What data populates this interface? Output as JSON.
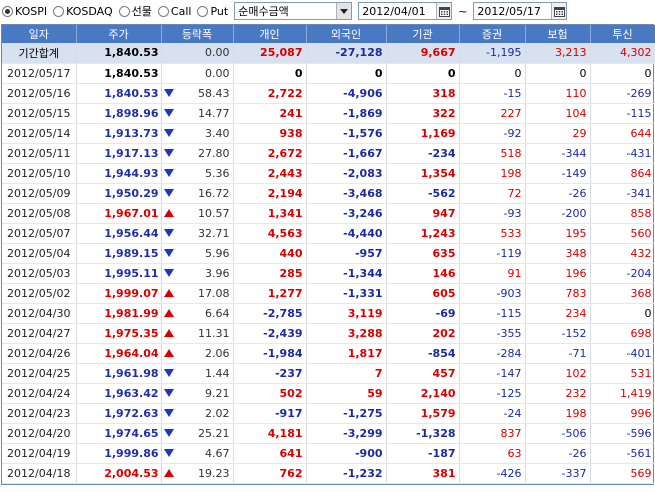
{
  "market_options": [
    {
      "label": "KOSPI",
      "selected": true
    },
    {
      "label": "KOSDAQ",
      "selected": false
    },
    {
      "label": "선물",
      "selected": false
    },
    {
      "label": "Call",
      "selected": false
    },
    {
      "label": "Put",
      "selected": false
    }
  ],
  "metric_select": {
    "value": "순매수금액"
  },
  "date_from": "2012/04/01",
  "date_sep": "~",
  "date_to": "2012/05/17",
  "columns": [
    "일자",
    "주가",
    "등락폭",
    "개인",
    "외국인",
    "기관",
    "증권",
    "보험",
    "투신"
  ],
  "rows": [
    {
      "date": "기간합계",
      "price": "1,840.53",
      "dir": "none",
      "chg": "0.00",
      "ind": "25,087",
      "for": "-27,128",
      "inst": "9,667",
      "sec": "-1,195",
      "ins": "3,213",
      "tru": "4,302",
      "total": true
    },
    {
      "date": "2012/05/17",
      "price": "1,840.53",
      "dir": "none",
      "chg": "0.00",
      "ind": "0",
      "for": "0",
      "inst": "0",
      "sec": "0",
      "ins": "0",
      "tru": "0"
    },
    {
      "date": "2012/05/16",
      "price": "1,840.53",
      "dir": "down",
      "chg": "58.43",
      "ind": "2,722",
      "for": "-4,906",
      "inst": "318",
      "sec": "-15",
      "ins": "110",
      "tru": "-269"
    },
    {
      "date": "2012/05/15",
      "price": "1,898.96",
      "dir": "down",
      "chg": "14.77",
      "ind": "241",
      "for": "-1,869",
      "inst": "322",
      "sec": "227",
      "ins": "104",
      "tru": "-115"
    },
    {
      "date": "2012/05/14",
      "price": "1,913.73",
      "dir": "down",
      "chg": "3.40",
      "ind": "938",
      "for": "-1,576",
      "inst": "1,169",
      "sec": "-92",
      "ins": "29",
      "tru": "644"
    },
    {
      "date": "2012/05/11",
      "price": "1,917.13",
      "dir": "down",
      "chg": "27.80",
      "ind": "2,672",
      "for": "-1,667",
      "inst": "-234",
      "sec": "518",
      "ins": "-344",
      "tru": "-431"
    },
    {
      "date": "2012/05/10",
      "price": "1,944.93",
      "dir": "down",
      "chg": "5.36",
      "ind": "2,443",
      "for": "-2,083",
      "inst": "1,354",
      "sec": "198",
      "ins": "-149",
      "tru": "864"
    },
    {
      "date": "2012/05/09",
      "price": "1,950.29",
      "dir": "down",
      "chg": "16.72",
      "ind": "2,194",
      "for": "-3,468",
      "inst": "-562",
      "sec": "72",
      "ins": "-26",
      "tru": "-341"
    },
    {
      "date": "2012/05/08",
      "price": "1,967.01",
      "dir": "up",
      "chg": "10.57",
      "ind": "1,341",
      "for": "-3,246",
      "inst": "947",
      "sec": "-93",
      "ins": "-200",
      "tru": "858"
    },
    {
      "date": "2012/05/07",
      "price": "1,956.44",
      "dir": "down",
      "chg": "32.71",
      "ind": "4,563",
      "for": "-4,440",
      "inst": "1,243",
      "sec": "533",
      "ins": "195",
      "tru": "560"
    },
    {
      "date": "2012/05/04",
      "price": "1,989.15",
      "dir": "down",
      "chg": "5.96",
      "ind": "440",
      "for": "-957",
      "inst": "635",
      "sec": "-119",
      "ins": "348",
      "tru": "432"
    },
    {
      "date": "2012/05/03",
      "price": "1,995.11",
      "dir": "down",
      "chg": "3.96",
      "ind": "285",
      "for": "-1,344",
      "inst": "146",
      "sec": "91",
      "ins": "196",
      "tru": "-204"
    },
    {
      "date": "2012/05/02",
      "price": "1,999.07",
      "dir": "up",
      "chg": "17.08",
      "ind": "1,277",
      "for": "-1,331",
      "inst": "605",
      "sec": "-903",
      "ins": "783",
      "tru": "368"
    },
    {
      "date": "2012/04/30",
      "price": "1,981.99",
      "dir": "up",
      "chg": "6.64",
      "ind": "-2,785",
      "for": "3,119",
      "inst": "-69",
      "sec": "-115",
      "ins": "234",
      "tru": "0"
    },
    {
      "date": "2012/04/27",
      "price": "1,975.35",
      "dir": "up",
      "chg": "11.31",
      "ind": "-2,439",
      "for": "3,288",
      "inst": "202",
      "sec": "-355",
      "ins": "-152",
      "tru": "698"
    },
    {
      "date": "2012/04/26",
      "price": "1,964.04",
      "dir": "up",
      "chg": "2.06",
      "ind": "-1,984",
      "for": "1,817",
      "inst": "-854",
      "sec": "-284",
      "ins": "-71",
      "tru": "-401"
    },
    {
      "date": "2012/04/25",
      "price": "1,961.98",
      "dir": "down",
      "chg": "1.44",
      "ind": "-237",
      "for": "7",
      "inst": "457",
      "sec": "-147",
      "ins": "102",
      "tru": "531"
    },
    {
      "date": "2012/04/24",
      "price": "1,963.42",
      "dir": "down",
      "chg": "9.21",
      "ind": "502",
      "for": "59",
      "inst": "2,140",
      "sec": "-125",
      "ins": "232",
      "tru": "1,419"
    },
    {
      "date": "2012/04/23",
      "price": "1,972.63",
      "dir": "down",
      "chg": "2.02",
      "ind": "-917",
      "for": "-1,275",
      "inst": "1,579",
      "sec": "-24",
      "ins": "198",
      "tru": "996"
    },
    {
      "date": "2012/04/20",
      "price": "1,974.65",
      "dir": "down",
      "chg": "25.21",
      "ind": "4,181",
      "for": "-3,299",
      "inst": "-1,328",
      "sec": "837",
      "ins": "-506",
      "tru": "-596"
    },
    {
      "date": "2012/04/19",
      "price": "1,999.86",
      "dir": "down",
      "chg": "4.67",
      "ind": "641",
      "for": "-900",
      "inst": "-187",
      "sec": "63",
      "ins": "-26",
      "tru": "-561"
    },
    {
      "date": "2012/04/18",
      "price": "2,004.53",
      "dir": "up",
      "chg": "19.23",
      "ind": "762",
      "for": "-1,232",
      "inst": "381",
      "sec": "-426",
      "ins": "-337",
      "tru": "569"
    }
  ]
}
